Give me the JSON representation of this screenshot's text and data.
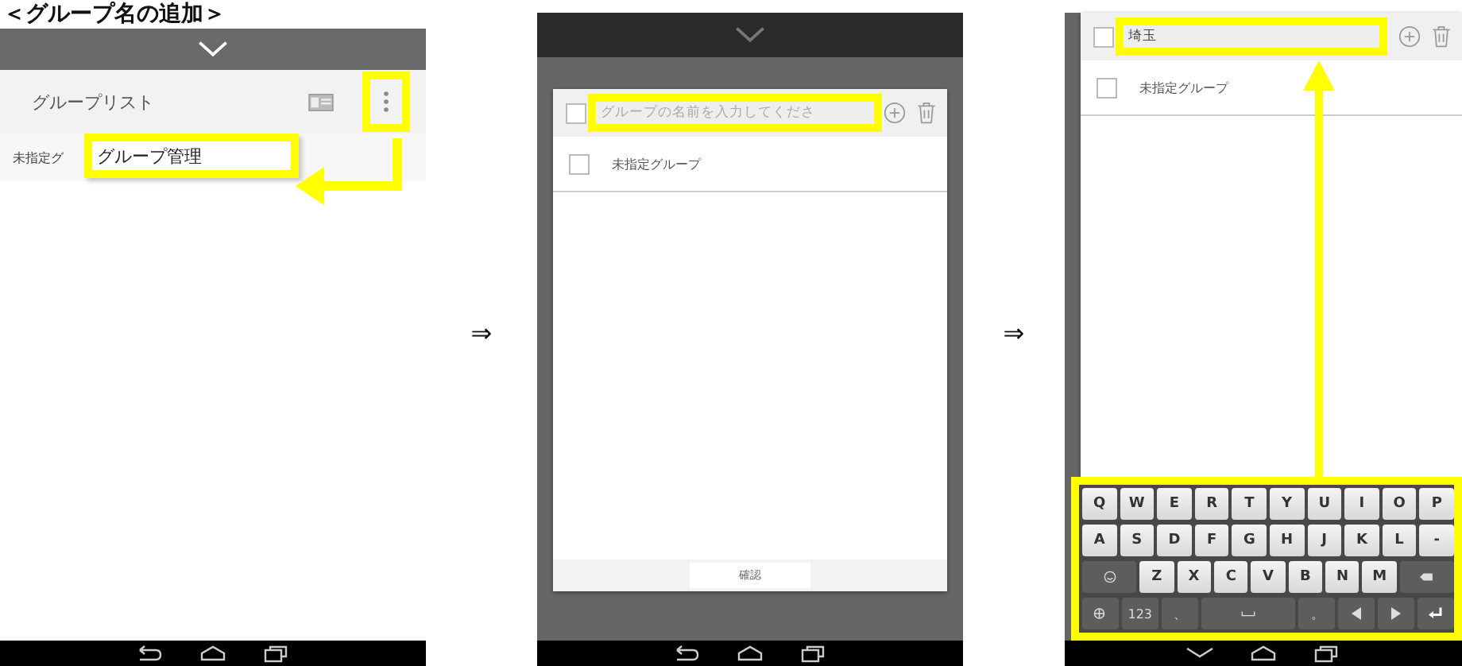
{
  "heading": "＜グループ名の追加＞",
  "step_arrows": [
    "⇒",
    "⇒"
  ],
  "screen1": {
    "title": "グループリスト",
    "row_text": "未指定グ",
    "menu_item": "グループ管理"
  },
  "screen2": {
    "placeholder": "グループの名前を入力してくださ",
    "select_all_checked": false,
    "rows": [
      {
        "label": "未指定グループ",
        "checked": false
      }
    ],
    "confirm": "確認"
  },
  "screen3": {
    "value": "埼玉",
    "select_all_checked": false,
    "rows": [
      {
        "label": "未指定グループ",
        "checked": false
      }
    ],
    "keyboard": [
      [
        {
          "kind": "key",
          "label": "Q"
        },
        {
          "kind": "key",
          "label": "W"
        },
        {
          "kind": "key",
          "label": "E"
        },
        {
          "kind": "key",
          "label": "R"
        },
        {
          "kind": "key",
          "label": "T"
        },
        {
          "kind": "key",
          "label": "Y"
        },
        {
          "kind": "key",
          "label": "U"
        },
        {
          "kind": "key",
          "label": "I"
        },
        {
          "kind": "key",
          "label": "O"
        },
        {
          "kind": "key",
          "label": "P"
        }
      ],
      [
        {
          "kind": "key",
          "label": "A"
        },
        {
          "kind": "key",
          "label": "S"
        },
        {
          "kind": "key",
          "label": "D"
        },
        {
          "kind": "key",
          "label": "F"
        },
        {
          "kind": "key",
          "label": "G"
        },
        {
          "kind": "key",
          "label": "H"
        },
        {
          "kind": "key",
          "label": "J"
        },
        {
          "kind": "key",
          "label": "K"
        },
        {
          "kind": "key",
          "label": "L"
        },
        {
          "kind": "key",
          "label": "-"
        }
      ],
      [
        {
          "kind": "symbol"
        },
        {
          "kind": "key",
          "label": "Z"
        },
        {
          "kind": "key",
          "label": "X"
        },
        {
          "kind": "key",
          "label": "C"
        },
        {
          "kind": "key",
          "label": "V"
        },
        {
          "kind": "key",
          "label": "B"
        },
        {
          "kind": "key",
          "label": "N"
        },
        {
          "kind": "key",
          "label": "M"
        },
        {
          "kind": "backspace"
        }
      ],
      [
        {
          "kind": "lang"
        },
        {
          "kind": "fn",
          "label": "123"
        },
        {
          "kind": "fn",
          "label": "、"
        },
        {
          "kind": "space"
        },
        {
          "kind": "fn",
          "label": "。"
        },
        {
          "kind": "left"
        },
        {
          "kind": "right"
        },
        {
          "kind": "enter"
        }
      ]
    ]
  }
}
